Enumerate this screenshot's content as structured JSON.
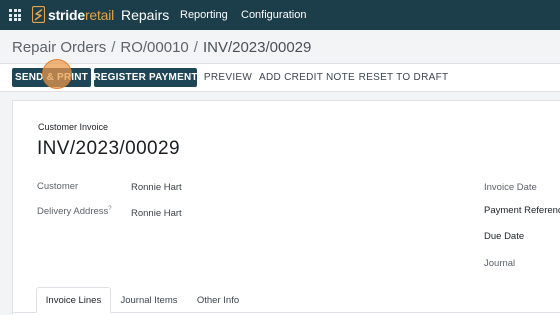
{
  "nav": {
    "brand_a": "stride",
    "brand_b": "retail",
    "app": "Repairs",
    "menu": [
      "Reporting",
      "Configuration"
    ]
  },
  "breadcrumb": {
    "items": [
      "Repair Orders",
      "RO/00010",
      "INV/2023/00029"
    ],
    "separator": "/"
  },
  "actions": {
    "buttons": [
      "SEND & PRINT",
      "REGISTER PAYMENT",
      "PREVIEW",
      "ADD CREDIT NOTE",
      "RESET TO DRAFT"
    ]
  },
  "invoice": {
    "type": "Customer Invoice",
    "number": "INV/2023/00029",
    "fields": {
      "customer_label": "Customer",
      "customer_value": "Ronnie Hart",
      "delivery_label": "Delivery Address",
      "delivery_help": "?",
      "delivery_value": "Ronnie Hart"
    },
    "right_fields": [
      "Invoice Date",
      "Payment Reference",
      "Due Date",
      "Journal"
    ]
  },
  "tabs": [
    "Invoice Lines",
    "Journal Items",
    "Other Info"
  ],
  "colors": {
    "nav_bg": "#1c3d4a",
    "primary_button": "#1e4656",
    "brand_accent": "#e3a24a",
    "click_highlight": "#ec984a"
  }
}
